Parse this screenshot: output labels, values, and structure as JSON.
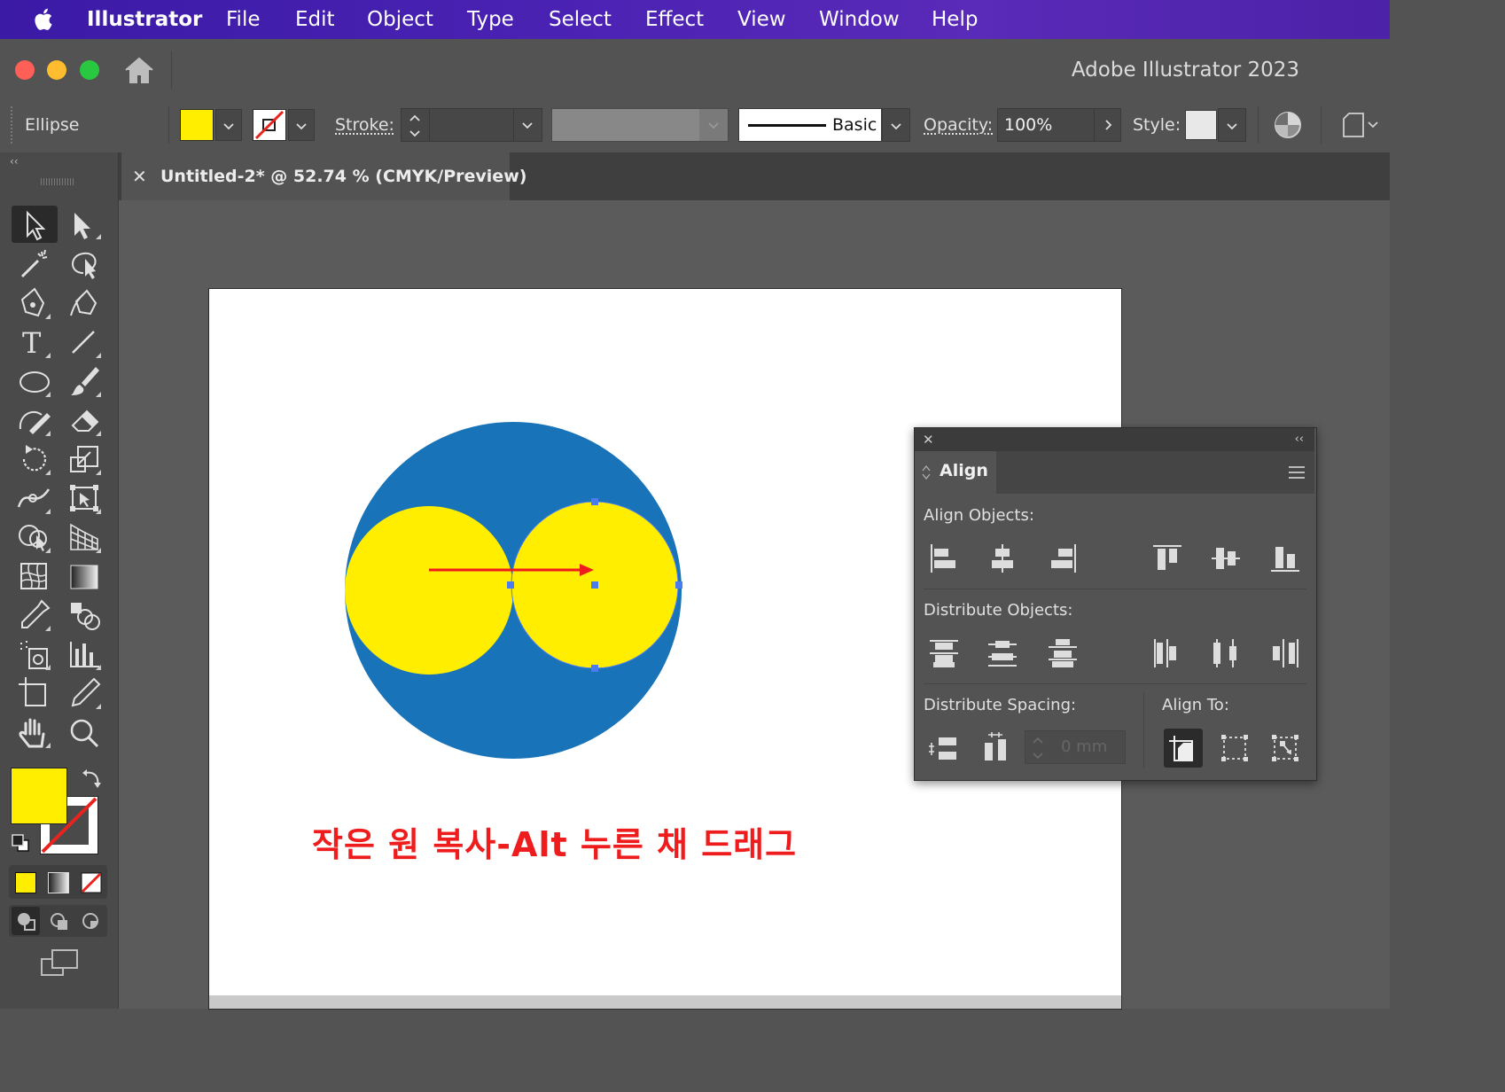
{
  "menubar": {
    "app_name": "Illustrator",
    "items": [
      "File",
      "Edit",
      "Object",
      "Type",
      "Select",
      "Effect",
      "View",
      "Window",
      "Help"
    ]
  },
  "titlebar": {
    "title": "Adobe Illustrator 2023"
  },
  "controlbar": {
    "object_type": "Ellipse",
    "stroke_label": "Stroke:",
    "brush_label": "Basic",
    "opacity_label": "Opacity:",
    "opacity_value": "100%",
    "style_label": "Style:"
  },
  "document": {
    "tab_title": "Untitled-2* @ 52.74 % (CMYK/Preview)"
  },
  "artwork": {
    "caption": "작은 원 복사-Alt 누른 채 드래그",
    "colors": {
      "big_circle": "#1873b8",
      "small_circles": "#ffee00",
      "arrow": "#ee1c1c",
      "caption": "#ee1c1c",
      "selection": "#4a7cf0"
    }
  },
  "align_panel": {
    "title": "Align",
    "align_objects": "Align Objects:",
    "distribute_objects": "Distribute Objects:",
    "distribute_spacing": "Distribute Spacing:",
    "align_to": "Align To:",
    "spacing_placeholder": "0 mm"
  },
  "colors": {
    "fill": "#ffee00",
    "menubar": "#4a22b3"
  }
}
